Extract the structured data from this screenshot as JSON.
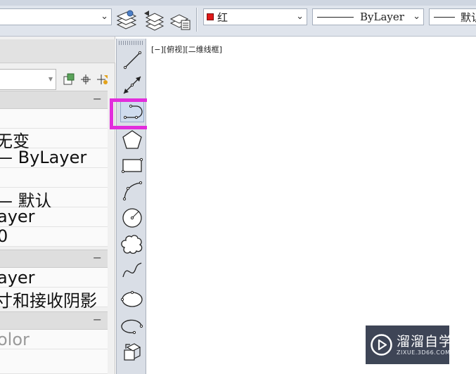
{
  "toolbar": {
    "color_value": "红",
    "color_swatch": "#e01818",
    "linetype_value": "ByLayer",
    "lineweight_value": "默认",
    "icons": [
      "layer-states-icon",
      "layer-previous-icon",
      "layer-properties-icon"
    ]
  },
  "properties_palette": {
    "rows": [
      {
        "text": "无变"
      },
      {
        "text": "— ByLayer"
      },
      {
        "text": "— 默认"
      },
      {
        "text": "ayer"
      },
      {
        "text": "0"
      },
      {
        "text": "ayer"
      },
      {
        "text": "寸和接收阴影"
      },
      {
        "text": "olor"
      }
    ],
    "section_collapse_symbol": "−"
  },
  "draw_toolbar": {
    "tools": [
      "line-icon",
      "construction-line-icon",
      "polyline-icon",
      "polygon-icon",
      "rectangle-icon",
      "arc-icon",
      "circle-icon",
      "revision-cloud-icon",
      "spline-icon",
      "ellipse-icon",
      "ellipse-arc-icon",
      "insert-block-icon"
    ]
  },
  "viewport": {
    "label": "[−][俯视][二维线框]"
  },
  "watermark": {
    "title": "溜溜自学",
    "url": "ZIXUE.3D66.COM"
  },
  "colors": {
    "highlight": "#e22ddc",
    "toolbar_bg": "#dfe4ec"
  }
}
